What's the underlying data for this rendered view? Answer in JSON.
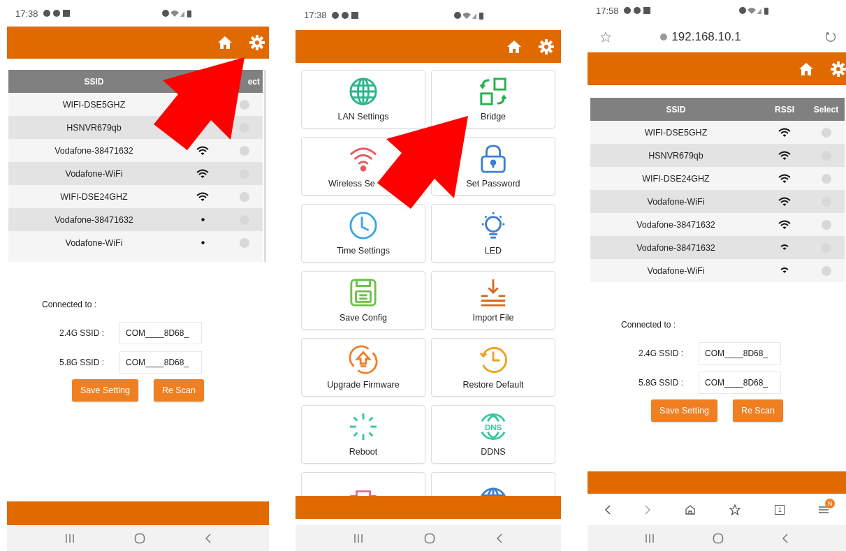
{
  "panels": [
    {
      "kind": "scan",
      "status_bar": {
        "time": "17:38"
      },
      "pointer": true,
      "table": {
        "columns": {
          "ssid": "SSID",
          "select": "ect"
        },
        "rows": [
          {
            "ssid": "WIFI-DSE5GHZ",
            "selected": false
          },
          {
            "ssid": "HSNVR679qb",
            "selected": false
          },
          {
            "ssid": "Vodafone-38471632",
            "kind": "full",
            "selected": false
          },
          {
            "ssid": "Vodafone-WiFi",
            "kind": "full",
            "selected": false
          },
          {
            "ssid": "WIFI-DSE24GHZ",
            "kind": "full",
            "selected": false
          },
          {
            "ssid": "Vodafone-38471632",
            "kind": "dot",
            "selected": false
          },
          {
            "ssid": "Vodafone-WiFi",
            "kind": "dot",
            "selected": false
          }
        ]
      },
      "connected": {
        "label": "Connected to :",
        "fields": [
          {
            "label": "2.4G SSID :",
            "value": "COM____8D68_"
          },
          {
            "label": "5.8G SSID :",
            "value": "COM____8D68_"
          }
        ]
      },
      "buttons": [
        "Save Setting",
        "Re Scan"
      ]
    },
    {
      "kind": "menu",
      "status_bar": {
        "time": "17:38"
      },
      "pointer": true,
      "tiles": [
        {
          "kind": "globe",
          "label": "LAN Settings"
        },
        {
          "kind": "bridge",
          "label": "Bridge"
        },
        {
          "kind": "wifi",
          "label": "Wireless Se",
          "label_cut": true
        },
        {
          "kind": "lock",
          "label": "Set Password"
        },
        {
          "kind": "clock",
          "label": "Time Settings"
        },
        {
          "kind": "bulb",
          "label": "LED"
        },
        {
          "kind": "floppy",
          "label": "Save Config"
        },
        {
          "kind": "import",
          "label": "Import File"
        },
        {
          "kind": "upgrade",
          "label": "Upgrade Firmware"
        },
        {
          "kind": "restore",
          "label": "Restore Default"
        },
        {
          "kind": "reboot",
          "label": "Reboot"
        },
        {
          "kind": "dns",
          "label": "DDNS",
          "icon_text": "DNS"
        },
        {
          "kind": "ethernet"
        },
        {
          "kind": "globe2"
        }
      ]
    },
    {
      "kind": "scan",
      "status_bar": {
        "time": "17:58"
      },
      "browser": {
        "url": "192.168.10.1",
        "tabs_count": "1",
        "menu_badge": "N"
      },
      "table": {
        "columns": {
          "ssid": "SSID",
          "rssi": "RSSI",
          "select": "Select"
        },
        "rows": [
          {
            "ssid": "WIFI-DSE5GHZ",
            "kind": "full",
            "selected": false
          },
          {
            "ssid": "HSNVR679qb",
            "kind": "full",
            "selected": false
          },
          {
            "ssid": "WIFI-DSE24GHZ",
            "kind": "full",
            "selected": false
          },
          {
            "ssid": "Vodafone-WiFi",
            "kind": "full",
            "selected": false
          },
          {
            "ssid": "Vodafone-38471632",
            "kind": "full",
            "selected": false
          },
          {
            "ssid": "Vodafone-38471632",
            "kind": "low",
            "selected": false
          },
          {
            "ssid": "Vodafone-WiFi",
            "kind": "low",
            "selected": false
          }
        ]
      },
      "connected": {
        "label": "Connected to :",
        "fields": [
          {
            "label": "2.4G SSID :",
            "value": "COM____8D68_"
          },
          {
            "label": "5.8G SSID :",
            "value": "COM____8D68_"
          }
        ]
      },
      "buttons": [
        "Save Setting",
        "Re Scan"
      ]
    }
  ]
}
